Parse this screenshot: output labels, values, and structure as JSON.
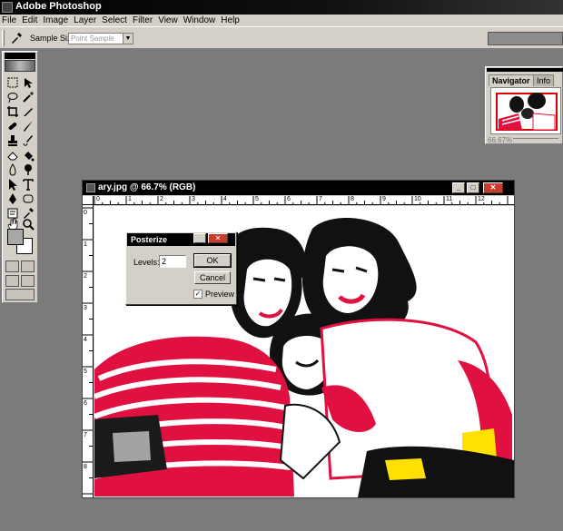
{
  "app": {
    "title": "Adobe Photoshop"
  },
  "menu": {
    "items": [
      "File",
      "Edit",
      "Image",
      "Layer",
      "Select",
      "Filter",
      "View",
      "Window",
      "Help"
    ]
  },
  "options_bar": {
    "tool_icon": "eyedropper-icon",
    "sample_size_label": "Sample Size:",
    "sample_size_value": "Point Sample"
  },
  "toolbox": {
    "tools": [
      "marquee-icon",
      "move-icon",
      "lasso-icon",
      "magic-wand-icon",
      "crop-icon",
      "slice-icon",
      "healing-brush-icon",
      "brush-icon",
      "clone-stamp-icon",
      "history-brush-icon",
      "eraser-icon",
      "paint-bucket-icon",
      "blur-icon",
      "dodge-icon",
      "path-selection-icon",
      "type-icon",
      "pen-icon",
      "shape-icon",
      "notes-icon",
      "eyedropper-icon",
      "hand-icon",
      "zoom-icon"
    ],
    "foreground_color": "#a8a8a8",
    "background_color": "#ffffff"
  },
  "navigator": {
    "tab_navigator": "Navigator",
    "tab_info": "Info",
    "zoom": "66.67%"
  },
  "document": {
    "title": "ary.jpg @ 66.7% (RGB)",
    "ruler_h": [
      "0",
      "1",
      "2",
      "3",
      "4",
      "5",
      "6",
      "7",
      "8",
      "9",
      "10",
      "11",
      "12"
    ],
    "ruler_v": [
      "0",
      "1",
      "2",
      "3",
      "4",
      "5",
      "6",
      "7",
      "8"
    ]
  },
  "dialog": {
    "title": "Posterize",
    "levels_label": "Levels:",
    "levels_value": "2",
    "ok_label": "OK",
    "cancel_label": "Cancel",
    "preview_label": "Preview",
    "preview_checked": true
  }
}
